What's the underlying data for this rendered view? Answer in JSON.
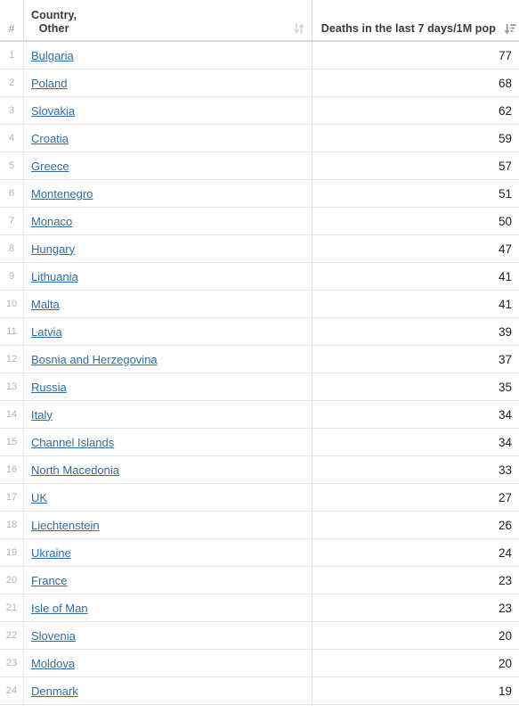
{
  "table": {
    "columns": {
      "rank_header": "#",
      "country_header": "Country,\nOther",
      "value_header": "Deaths in the last 7 days/1M pop",
      "country_sort_icon": "sort-both-icon",
      "value_sort_icon": "sort-descending-icon"
    },
    "link_color": "#2e6da4",
    "rows": [
      {
        "rank": "1",
        "country": "Bulgaria",
        "value": "77"
      },
      {
        "rank": "2",
        "country": "Poland",
        "value": "68"
      },
      {
        "rank": "3",
        "country": "Slovakia",
        "value": "62"
      },
      {
        "rank": "4",
        "country": "Croatia",
        "value": "59"
      },
      {
        "rank": "5",
        "country": "Greece",
        "value": "57"
      },
      {
        "rank": "6",
        "country": "Montenegro",
        "value": "51"
      },
      {
        "rank": "7",
        "country": "Monaco",
        "value": "50"
      },
      {
        "rank": "8",
        "country": "Hungary",
        "value": "47"
      },
      {
        "rank": "9",
        "country": "Lithuania",
        "value": "41"
      },
      {
        "rank": "10",
        "country": "Malta",
        "value": "41"
      },
      {
        "rank": "11",
        "country": "Latvia",
        "value": "39"
      },
      {
        "rank": "12",
        "country": "Bosnia and Herzegovina",
        "value": "37"
      },
      {
        "rank": "13",
        "country": "Russia",
        "value": "35"
      },
      {
        "rank": "14",
        "country": "Italy",
        "value": "34"
      },
      {
        "rank": "15",
        "country": "Channel Islands",
        "value": "34"
      },
      {
        "rank": "16",
        "country": "North Macedonia",
        "value": "33"
      },
      {
        "rank": "17",
        "country": "UK",
        "value": "27"
      },
      {
        "rank": "18",
        "country": "Liechtenstein",
        "value": "26"
      },
      {
        "rank": "19",
        "country": "Ukraine",
        "value": "24"
      },
      {
        "rank": "20",
        "country": "France",
        "value": "23"
      },
      {
        "rank": "21",
        "country": "Isle of Man",
        "value": "23"
      },
      {
        "rank": "22",
        "country": "Slovenia",
        "value": "20"
      },
      {
        "rank": "23",
        "country": "Moldova",
        "value": "20"
      },
      {
        "rank": "24",
        "country": "Denmark",
        "value": "19"
      }
    ]
  },
  "chart_data": {
    "type": "table",
    "title": "Deaths in the last 7 days/1M pop",
    "categories": [
      "Bulgaria",
      "Poland",
      "Slovakia",
      "Croatia",
      "Greece",
      "Montenegro",
      "Monaco",
      "Hungary",
      "Lithuania",
      "Malta",
      "Latvia",
      "Bosnia and Herzegovina",
      "Russia",
      "Italy",
      "Channel Islands",
      "North Macedonia",
      "UK",
      "Liechtenstein",
      "Ukraine",
      "France",
      "Isle of Man",
      "Slovenia",
      "Moldova",
      "Denmark"
    ],
    "values": [
      77,
      68,
      62,
      59,
      57,
      51,
      50,
      47,
      41,
      41,
      39,
      37,
      35,
      34,
      34,
      33,
      27,
      26,
      24,
      23,
      23,
      20,
      20,
      19
    ],
    "xlabel": "Country, Other",
    "ylabel": "Deaths in the last 7 days/1M pop"
  }
}
